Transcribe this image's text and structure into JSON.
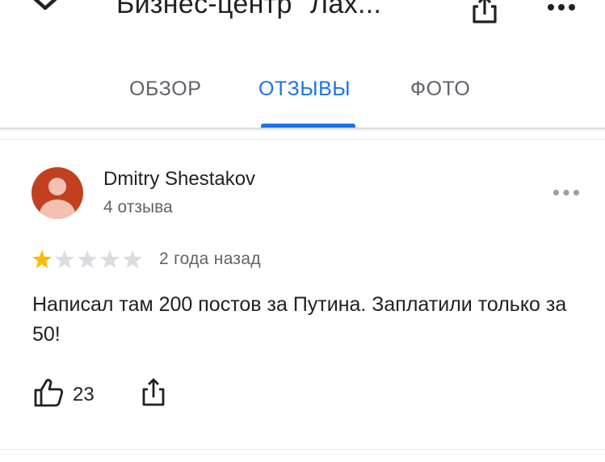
{
  "header": {
    "title": "Бизнес-центр \"Лах...",
    "back_icon": "chevron-down-icon",
    "share_icon": "share-icon",
    "more_icon": "more-horizontal-icon"
  },
  "tabs": [
    {
      "label": "ОБЗОР",
      "active": false
    },
    {
      "label": "ОТЗЫВЫ",
      "active": true
    },
    {
      "label": "ФОТО",
      "active": false
    }
  ],
  "review": {
    "author": "Dmitry Shestakov",
    "review_count": "4 отзыва",
    "rating": 1,
    "rating_max": 5,
    "date": "2 года назад",
    "text": "Написал там 200 постов за Путина. Заплатили только за 50!",
    "likes": "23",
    "like_icon": "thumbs-up-icon",
    "share_icon": "share-icon",
    "menu_icon": "more-horizontal-icon"
  },
  "colors": {
    "accent": "#1a73e8",
    "avatar_bg": "#c2401f",
    "avatar_fg": "#f2c1b3",
    "star_filled": "#fbbc04",
    "star_empty": "#dadce0",
    "secondary_text": "#5f6368"
  }
}
